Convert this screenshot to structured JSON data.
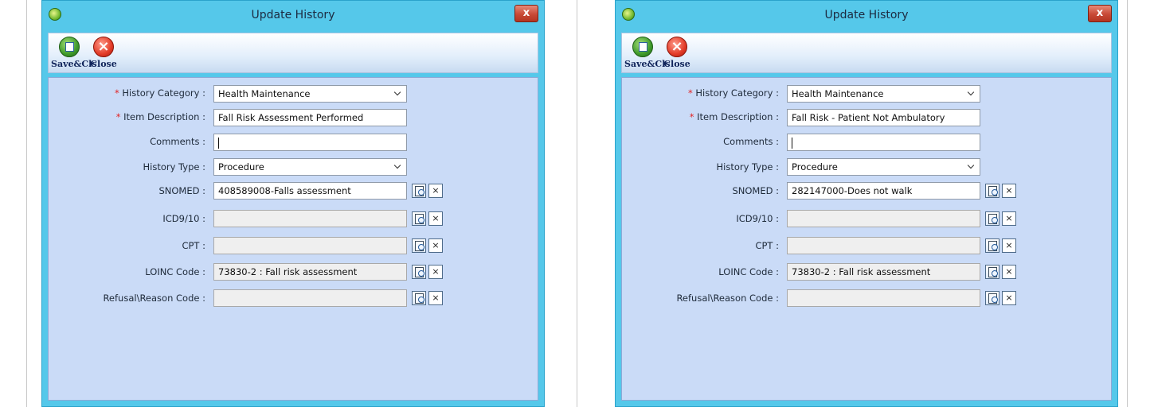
{
  "dialogs": [
    {
      "title": "Update History",
      "close_glyph": "x",
      "toolbar": {
        "save_label": "Save&Cls",
        "close_label": "Close"
      },
      "labels": {
        "history_category": "History Category :",
        "item_description": "Item Description :",
        "comments": "Comments :",
        "history_type": "History Type :",
        "snomed": "SNOMED :",
        "icd": "ICD9/10 :",
        "cpt": "CPT :",
        "loinc": "LOINC Code :",
        "refusal": "Refusal\\Reason Code :"
      },
      "required_mark": "*",
      "values": {
        "history_category": "Health Maintenance",
        "item_description": "Fall Risk Assessment Performed",
        "comments": "",
        "history_type": "Procedure",
        "snomed": "408589008-Falls assessment",
        "icd": "",
        "cpt": "",
        "loinc": "73830-2 : Fall risk assessment",
        "refusal": ""
      },
      "clear_glyph": "×"
    },
    {
      "title": "Update History",
      "close_glyph": "x",
      "toolbar": {
        "save_label": "Save&Cls",
        "close_label": "Close"
      },
      "labels": {
        "history_category": "History Category :",
        "item_description": "Item Description :",
        "comments": "Comments :",
        "history_type": "History Type :",
        "snomed": "SNOMED :",
        "icd": "ICD9/10 :",
        "cpt": "CPT :",
        "loinc": "LOINC Code :",
        "refusal": "Refusal\\Reason Code :"
      },
      "required_mark": "*",
      "values": {
        "history_category": "Health Maintenance",
        "item_description": "Fall Risk - Patient Not Ambulatory",
        "comments": "",
        "history_type": "Procedure",
        "snomed": "282147000-Does not walk",
        "icd": "",
        "cpt": "",
        "loinc": "73830-2 : Fall risk assessment",
        "refusal": ""
      },
      "clear_glyph": "×"
    }
  ],
  "colors": {
    "titlebar": "#55c8ea",
    "panel": "#cadbf7",
    "required": "#e22222"
  },
  "icons": [
    "app-icon",
    "window-close-icon",
    "save-close-icon",
    "close-icon",
    "lookup-icon",
    "clear-icon"
  ]
}
